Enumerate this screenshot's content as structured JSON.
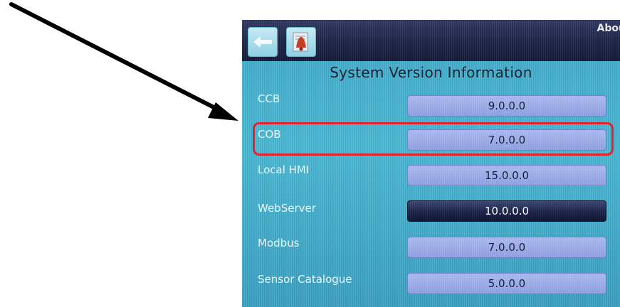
{
  "header": {
    "about_label": "Abou",
    "back_icon": "back-arrow-icon",
    "alarm_icon": "alarm-bell-icon"
  },
  "title": "System Version Information",
  "rows": [
    {
      "label": "CCB",
      "value": "9.0.0.0"
    },
    {
      "label": "COB",
      "value": "7.0.0.0"
    },
    {
      "label": "Local HMI",
      "value": "15.0.0.0"
    },
    {
      "label": "WebServer",
      "value": "10.0.0.0"
    },
    {
      "label": "Modbus",
      "value": "7.0.0.0"
    },
    {
      "label": "Sensor Catalogue",
      "value": "5.0.0.0"
    }
  ],
  "colors": {
    "highlight": "#e0232d",
    "annotation_arrow": "#000000"
  }
}
